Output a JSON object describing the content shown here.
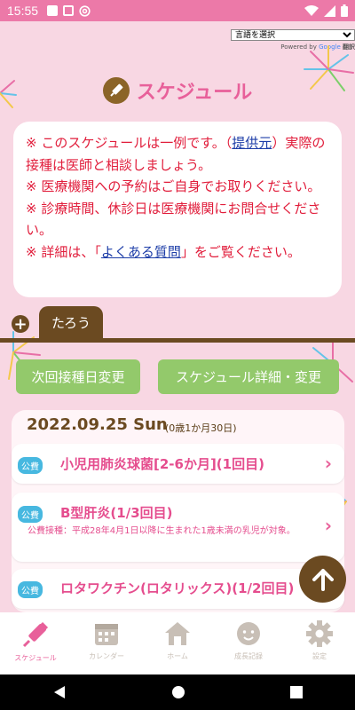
{
  "status_bar": {
    "time": "15:55"
  },
  "translate": {
    "select_label": "言語を選択",
    "powered_by": "Powered by",
    "google": "Google",
    "translate": "翻訳"
  },
  "header": {
    "title": "スケジュール"
  },
  "notice": {
    "line1_pre": "※ このスケジュールは一例です。（",
    "line1_link": "提供元",
    "line1_post": "）実際の接種は医師と相談しましょう。",
    "line2": "※ 医療機関への予約はご自身でお取りください。",
    "line3": "※ 診療時間、休診日は医療機関にお問合せください。",
    "line4_pre": "※ 詳細は、「",
    "line4_link": "よくある質問",
    "line4_post": "」をご覧ください。"
  },
  "tabs": {
    "add_label": "+",
    "active_tab": "たろう"
  },
  "actions": {
    "change_next_date": "次回接種日変更",
    "schedule_detail": "スケジュール詳細・変更"
  },
  "schedule": {
    "date": "2022.09.25 Sun",
    "age": "(0歳1か月30日)",
    "vaccines": [
      {
        "badge": "公費",
        "title": "小児用肺炎球菌[2-6か月](1回目)",
        "note": ""
      },
      {
        "badge": "公費",
        "title": "B型肝炎(1/3回目)",
        "note": "公費接種：平成28年4月1日以降に生まれた1歳未満の乳児が対象。"
      },
      {
        "badge": "公費",
        "title": "ロタワクチン(ロタリックス)(1/2回目)",
        "note": ""
      }
    ]
  },
  "bottom_nav": [
    {
      "label": "スケジュール",
      "icon": "syringe-icon",
      "active": true
    },
    {
      "label": "カレンダー",
      "icon": "calendar-icon",
      "active": false
    },
    {
      "label": "ホーム",
      "icon": "home-icon",
      "active": false
    },
    {
      "label": "成長記録",
      "icon": "baby-face-icon",
      "active": false
    },
    {
      "label": "設定",
      "icon": "gear-icon",
      "active": false
    }
  ],
  "colors": {
    "accent": "#e8609a",
    "brown": "#6b4a21",
    "green": "#93c96b",
    "status_bar": "#ec79a8",
    "background": "#f8d7e3"
  }
}
